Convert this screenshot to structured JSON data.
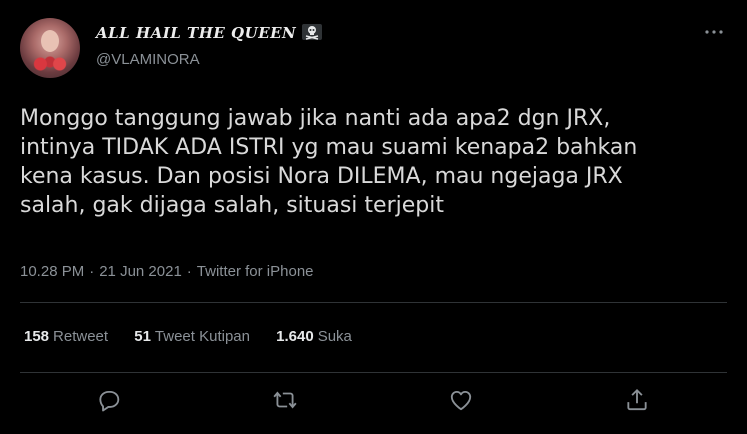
{
  "author": {
    "display_name": "ALL HAIL THE QUEEN",
    "handle": "@VLAMINORA",
    "badge_icon": "skull-crossbones-icon"
  },
  "tweet": {
    "lines": [
      "Monggo tanggung jawab jika nanti ada apa2 dgn JRX,",
      "intinya TIDAK ADA ISTRI yg mau suami kenapa2 bahkan",
      "kena kasus. Dan posisi Nora DILEMA, mau ngejaga JRX",
      "salah, gak dijaga salah, situasi terjepit"
    ],
    "time": "10.28 PM",
    "date": "21 Jun 2021",
    "source": "Twitter for iPhone",
    "separator": "·"
  },
  "stats": {
    "retweets": {
      "count": "158",
      "label": "Retweet"
    },
    "quotes": {
      "count": "51",
      "label": "Tweet Kutipan"
    },
    "likes": {
      "count": "1.640",
      "label": "Suka"
    }
  },
  "actions": [
    "reply-icon",
    "retweet-icon",
    "like-icon",
    "share-icon"
  ],
  "colors": {
    "background": "#000000",
    "text": "#d9d9d9",
    "muted": "#8b9197",
    "divider": "#2f3336"
  }
}
